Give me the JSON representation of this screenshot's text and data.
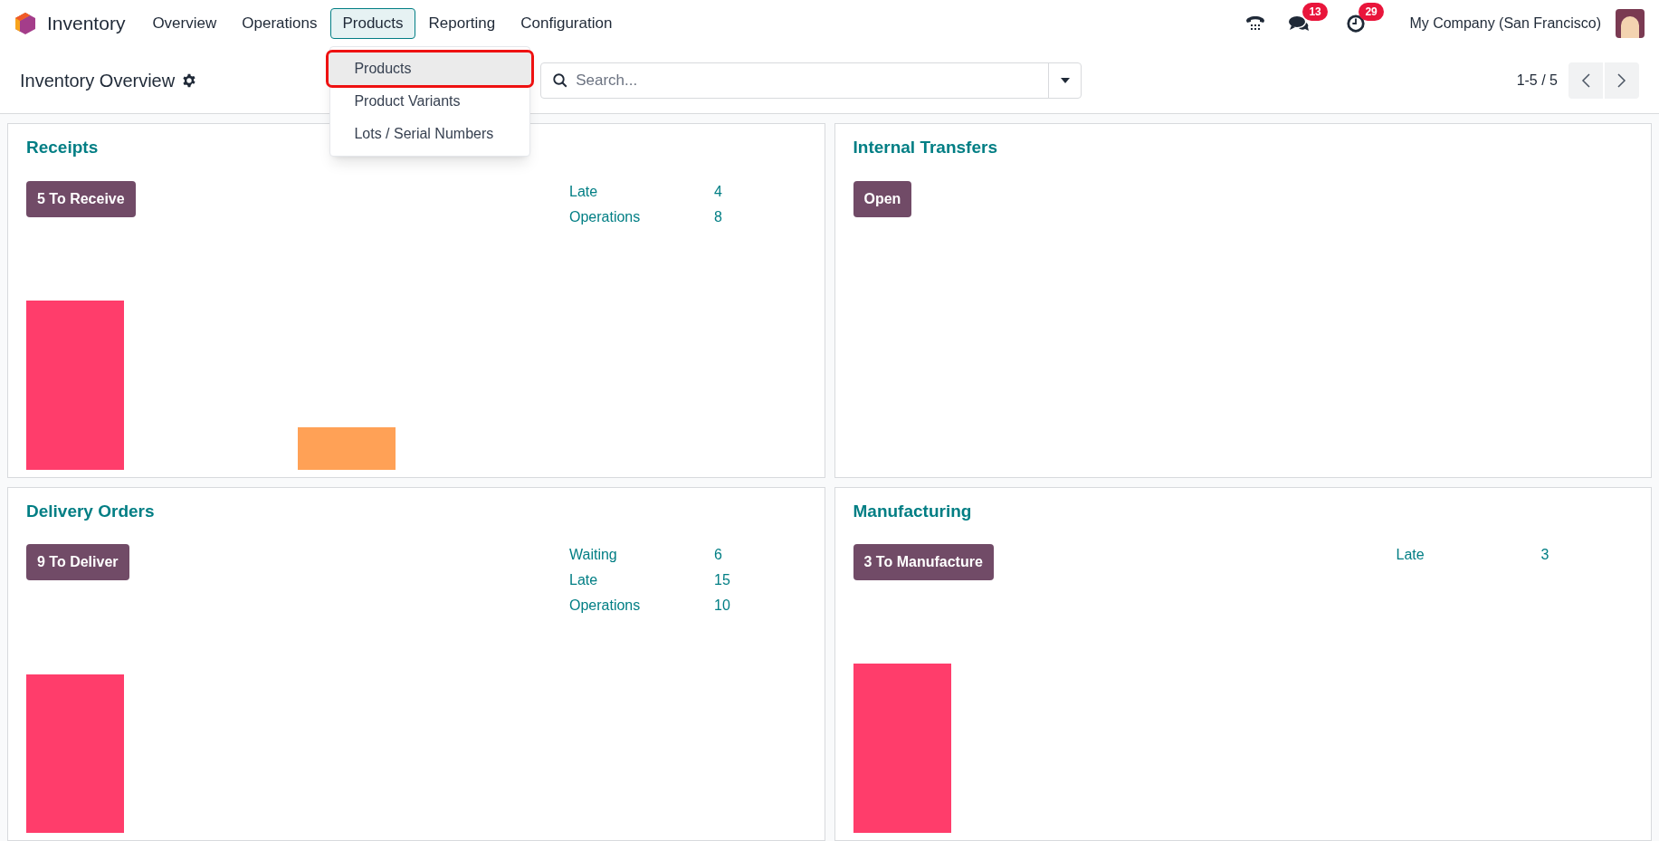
{
  "app": {
    "name": "Inventory"
  },
  "menu": [
    {
      "label": "Overview",
      "open": false
    },
    {
      "label": "Operations",
      "open": false
    },
    {
      "label": "Products",
      "open": true
    },
    {
      "label": "Reporting",
      "open": false
    },
    {
      "label": "Configuration",
      "open": false
    }
  ],
  "dropdown": [
    {
      "label": "Products",
      "selected": true
    },
    {
      "label": "Product Variants",
      "selected": false
    },
    {
      "label": "Lots / Serial Numbers",
      "selected": false
    }
  ],
  "systray": {
    "messages_badge": "13",
    "activities_badge": "29",
    "company": "My Company (San Francisco)"
  },
  "control_panel": {
    "title": "Inventory Overview",
    "search": {
      "placeholder": "Search..."
    },
    "pager": "1-5 / 5"
  },
  "cards": [
    {
      "title": "Receipts",
      "button": "5 To Receive",
      "stats": [
        {
          "label": "Late",
          "value": "4"
        },
        {
          "label": "Operations",
          "value": "8"
        }
      ]
    },
    {
      "title": "Internal Transfers",
      "button": "Open"
    },
    {
      "title": "Delivery Orders",
      "button": "9 To Deliver",
      "stats": [
        {
          "label": "Waiting",
          "value": "6"
        },
        {
          "label": "Late",
          "value": "15"
        },
        {
          "label": "Operations",
          "value": "10"
        }
      ]
    },
    {
      "title": "Manufacturing",
      "button": "3 To Manufacture",
      "stats": [
        {
          "label": "Late",
          "value": "3"
        }
      ]
    }
  ]
}
